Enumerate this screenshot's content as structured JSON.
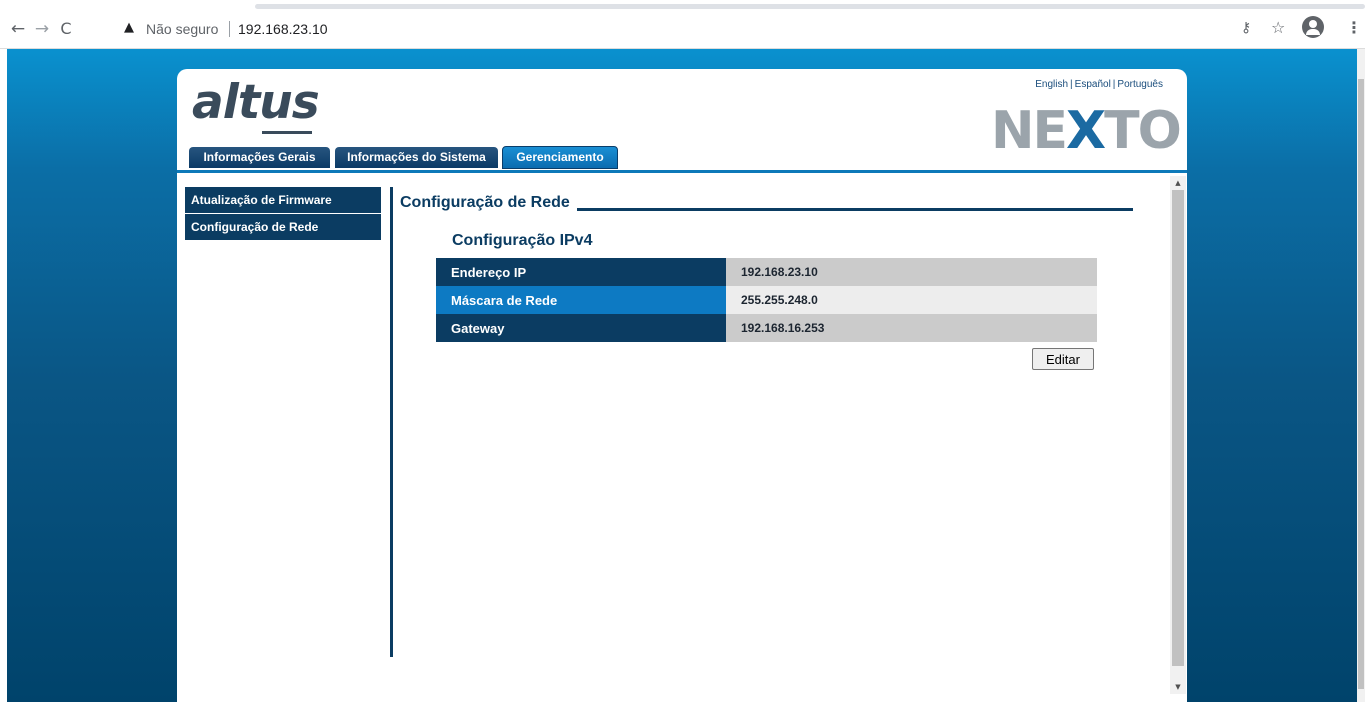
{
  "browser": {
    "nav": {
      "back": "←",
      "forward": "→",
      "reload": "C"
    },
    "security_label": "Não seguro",
    "url": "192.168.23.10",
    "icons": {
      "key": "key-icon",
      "star": "star-icon",
      "profile": "profile-icon",
      "menu": "menu-icon"
    }
  },
  "header": {
    "logo_left": "altus",
    "logo_right_a": "NE",
    "logo_right_x": "X",
    "logo_right_b": "TO",
    "languages": [
      "English",
      "Español",
      "Português"
    ],
    "lang_separator": "|"
  },
  "tabs": [
    {
      "label": "Informações Gerais"
    },
    {
      "label": "Informações do Sistema"
    },
    {
      "label": "Gerenciamento",
      "active": true
    }
  ],
  "sidebar": {
    "items": [
      {
        "label": "Atualização de Firmware"
      },
      {
        "label": "Configuração de Rede"
      }
    ]
  },
  "main": {
    "section_title": "Configuração de Rede",
    "subtitle": "Configuração IPv4",
    "rows": [
      {
        "label": "Endereço IP",
        "value": "192.168.23.10"
      },
      {
        "label": "Máscara de Rede",
        "value": "255.255.248.0"
      },
      {
        "label": "Gateway",
        "value": "192.168.16.253"
      }
    ],
    "edit_button": "Editar"
  },
  "colors": {
    "brand_dark": "#0b3c62",
    "brand_light": "#0d7ac3",
    "page_gradient_top": "#0a91cf",
    "page_gradient_bottom": "#00436b"
  }
}
